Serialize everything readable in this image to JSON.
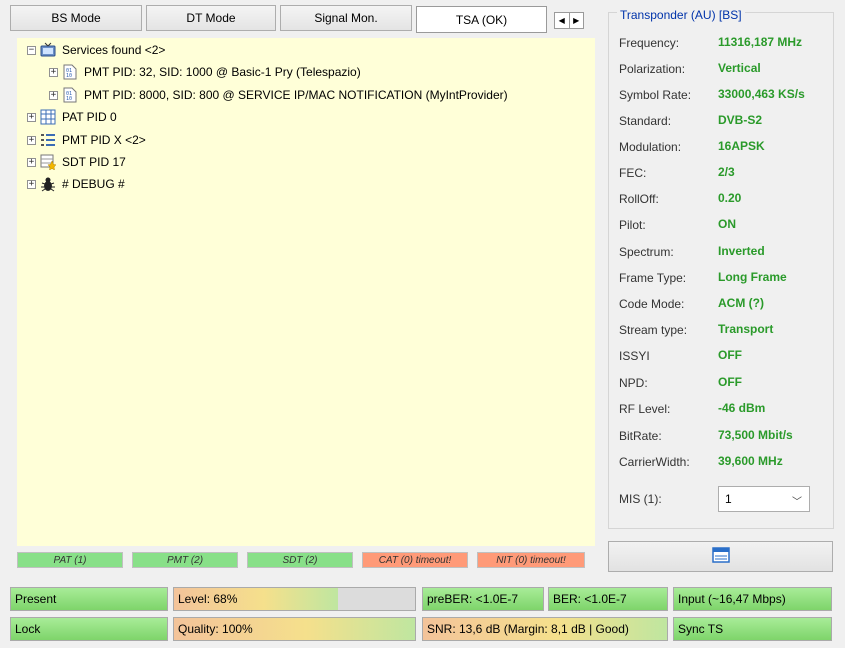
{
  "tabs": [
    "BS Mode",
    "DT Mode",
    "Signal Mon.",
    "TSA (OK)"
  ],
  "tree": {
    "root": "Services found <2>",
    "services": [
      "PMT PID: 32, SID: 1000 @ Basic-1 Pry (Telespazio)",
      "PMT PID: 8000, SID: 800 @ SERVICE IP/MAC NOTIFICATION (MyIntProvider)"
    ],
    "pat": "PAT PID 0",
    "pmt": "PMT PID X <2>",
    "sdt": "SDT PID 17",
    "debug": "# DEBUG #"
  },
  "table_status": [
    {
      "label": "PAT (1)",
      "state": "ok"
    },
    {
      "label": "PMT (2)",
      "state": "ok"
    },
    {
      "label": "SDT (2)",
      "state": "ok"
    },
    {
      "label": "CAT (0) timeout!",
      "state": "bad"
    },
    {
      "label": "NIT (0) timeout!",
      "state": "bad"
    }
  ],
  "transponder": {
    "title": "Transponder (AU) [BS]",
    "props": [
      {
        "label": "Frequency:",
        "value": "11316,187 MHz"
      },
      {
        "label": "Polarization:",
        "value": "Vertical"
      },
      {
        "label": "Symbol Rate:",
        "value": "33000,463 KS/s"
      },
      {
        "label": "Standard:",
        "value": "DVB-S2"
      },
      {
        "label": "Modulation:",
        "value": "16APSK"
      },
      {
        "label": "FEC:",
        "value": "2/3"
      },
      {
        "label": "RollOff:",
        "value": "0.20"
      },
      {
        "label": "Pilot:",
        "value": "ON"
      },
      {
        "label": "Spectrum:",
        "value": "Inverted"
      },
      {
        "label": "Frame Type:",
        "value": "Long Frame"
      },
      {
        "label": "Code Mode:",
        "value": "ACM (?)"
      },
      {
        "label": "Stream type:",
        "value": "Transport"
      },
      {
        "label": "ISSYI",
        "value": "OFF"
      },
      {
        "label": "NPD:",
        "value": "OFF"
      },
      {
        "label": "RF Level:",
        "value": "-46 dBm"
      },
      {
        "label": "BitRate:",
        "value": "73,500 Mbit/s"
      },
      {
        "label": "CarrierWidth:",
        "value": "39,600 MHz"
      }
    ],
    "mis_label": "MIS (1):",
    "mis_value": "1"
  },
  "indicators": {
    "present": "Present",
    "lock": "Lock",
    "level": "Level: 68%",
    "level_fraction": 0.68,
    "quality": "Quality: 100%",
    "quality_fraction": 1.0,
    "preber": "preBER: <1.0E-7",
    "ber": "BER: <1.0E-7",
    "snr": "SNR: 13,6 dB (Margin: 8,1 dB | Good)",
    "input": "Input (~16,47 Mbps)",
    "sync": "Sync TS"
  }
}
